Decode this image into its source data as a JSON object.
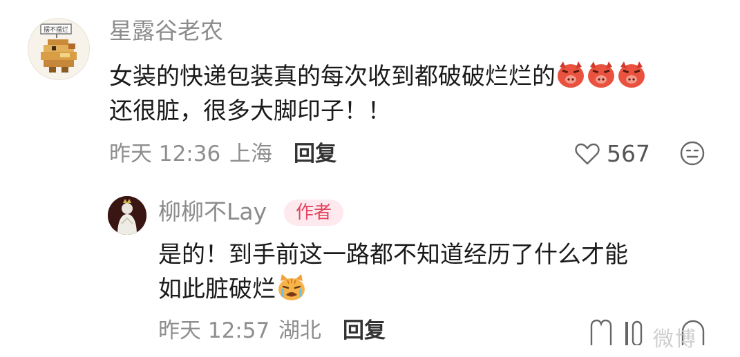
{
  "comment": {
    "username": "星露谷老农",
    "avatar_tag": "摆不摆烂",
    "content_line1": "女装的快递包装真的每次收到都破破烂烂的",
    "content_line2": "还很脏，很多大脚印子！！",
    "content_emoji": "angry-pig-emoji",
    "time": "昨天 12:36",
    "location": "上海",
    "reply_label": "回复",
    "like_count": "567"
  },
  "reply": {
    "username": "柳柳不Lay",
    "badge": "作者",
    "content_line1": "是的！到手前这一路都不知道经历了什么才能",
    "content_line2": "如此脏破烂",
    "content_emoji": "crying-cat-emoji",
    "time": "昨天 12:57",
    "location": "湖北",
    "reply_label": "回复"
  },
  "watermark": "微博",
  "colors": {
    "meta_gray": "#8e8e8e",
    "badge_bg": "#fde9ee",
    "badge_text": "#e4455f"
  }
}
